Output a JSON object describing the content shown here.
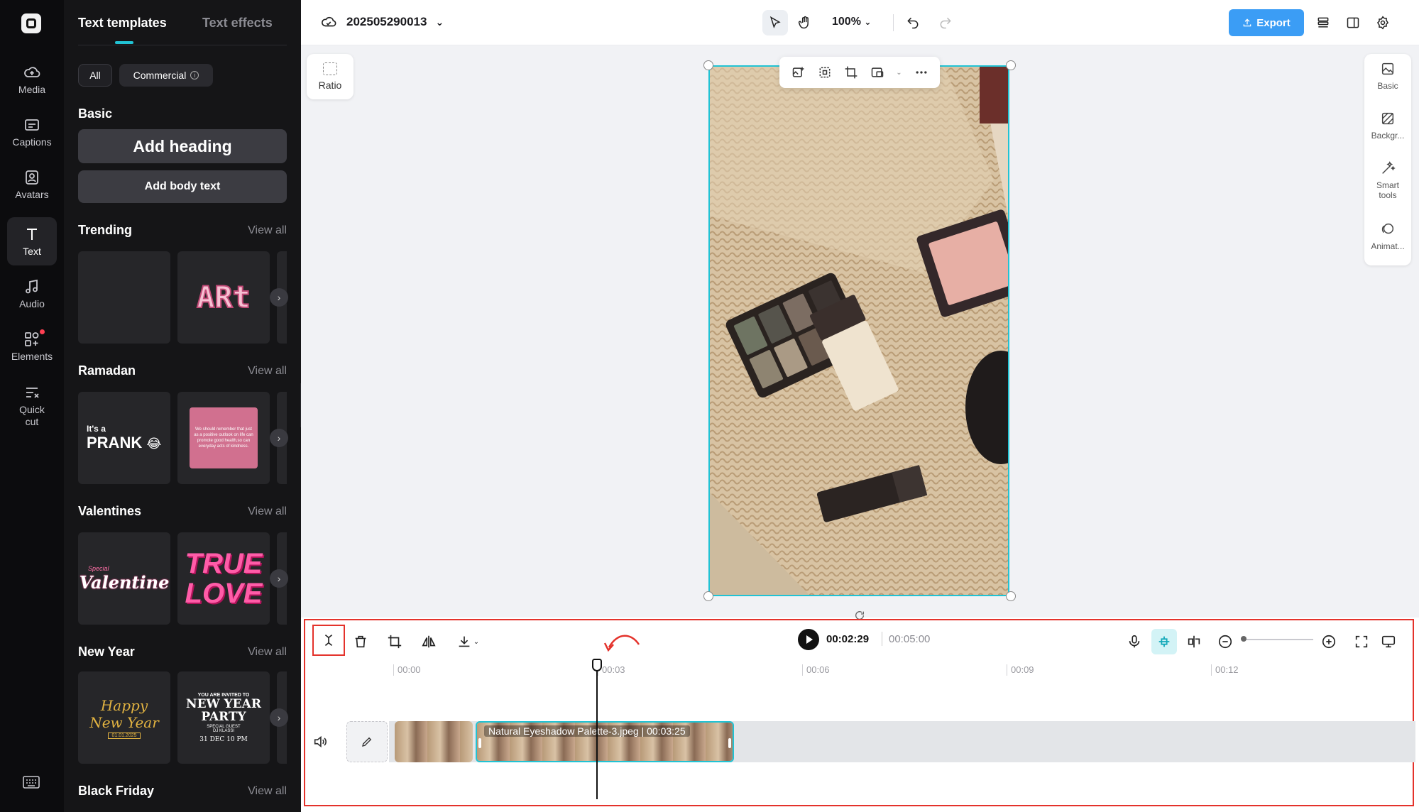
{
  "rail": {
    "items": [
      {
        "label": "Media",
        "icon": "cloud-upload-icon"
      },
      {
        "label": "Captions",
        "icon": "captions-icon"
      },
      {
        "label": "Avatars",
        "icon": "avatar-icon"
      },
      {
        "label": "Text",
        "icon": "text-icon"
      },
      {
        "label": "Audio",
        "icon": "music-note-icon"
      },
      {
        "label": "Elements",
        "icon": "elements-icon"
      },
      {
        "label": "Quick\ncut",
        "icon": "quick-cut-icon"
      }
    ],
    "active": "Text"
  },
  "panel": {
    "tab_templates": "Text templates",
    "tab_effects": "Text effects",
    "chip_all": "All",
    "chip_commercial": "Commercial",
    "basic_title": "Basic",
    "add_heading": "Add heading",
    "add_body": "Add body text",
    "view_all": "View all",
    "sections": [
      {
        "title": "Trending",
        "thumbs": [
          "",
          "ARt"
        ]
      },
      {
        "title": "Ramadan",
        "thumbs": [
          "It's a PRANK",
          "We should remember that just as a positive outlook on life can promote good health,so can everyday acts of kindness."
        ]
      },
      {
        "title": "Valentines",
        "thumbs": [
          "Valentine",
          "TRUE LOVE"
        ]
      },
      {
        "title": "New Year",
        "thumbs": [
          "Happy New Year",
          "NEW YEAR PARTY"
        ]
      },
      {
        "title": "Black Friday",
        "thumbs": []
      }
    ],
    "ramadan_prank_top": "It's a",
    "ramadan_prank_main": "PRANK",
    "valentine_small": "Special",
    "valentine_main": "Valentine",
    "truelove_1": "TRUE",
    "truelove_2": "LOVE",
    "ny_happy": "Happy",
    "ny_newyear": "New Year",
    "ny_date": "01.01.2025",
    "ny_invite": "YOU ARE INVITED TO",
    "ny_party1": "NEW YEAR",
    "ny_party2": "PARTY",
    "ny_guest": "SPECIAL GUEST",
    "ny_guest_name": "DJ KLASSI",
    "ny_when": "31 DEC 10 PM"
  },
  "topbar": {
    "project_name": "202505290013",
    "zoom": "100%",
    "export": "Export"
  },
  "canvas": {
    "ratio_label": "Ratio",
    "right_panel": [
      "Basic",
      "Backgr...",
      "Smart\ntools",
      "Animat..."
    ]
  },
  "timeline": {
    "current_time": "00:02:29",
    "total_time": "00:05:00",
    "ticks": [
      "00:00",
      "00:03",
      "00:06",
      "00:09",
      "00:12"
    ],
    "clip_label": "Natural Eyeshadow Palette-3.jpeg",
    "clip_duration": "00:03:25",
    "accent": "#21c3d4",
    "highlight": "#e4322b"
  }
}
